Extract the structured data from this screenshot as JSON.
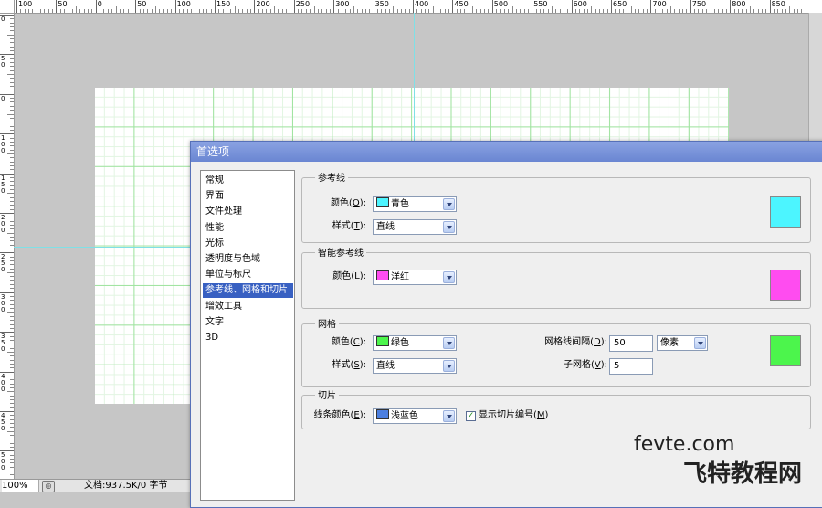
{
  "ruler": {
    "top_labels": [
      "100",
      "50",
      "0",
      "50",
      "100",
      "150",
      "200",
      "250",
      "300",
      "350",
      "400",
      "450",
      "500",
      "550",
      "600",
      "650",
      "700",
      "750",
      "800",
      "850"
    ],
    "left_labels": [
      "0",
      "50",
      "0",
      "100",
      "150",
      "200",
      "250",
      "300",
      "350",
      "400",
      "450",
      "500"
    ]
  },
  "status": {
    "zoom": "100%",
    "doc_info": "文档:937.5K/0 字节"
  },
  "dialog": {
    "title": "首选项",
    "nav_items": [
      "常规",
      "界面",
      "文件处理",
      "性能",
      "光标",
      "透明度与色域",
      "单位与标尺",
      "参考线、网格和切片",
      "增效工具",
      "文字",
      "3D"
    ],
    "selected_index": 7,
    "guides": {
      "title": "参考线",
      "color_label": "颜色(",
      "color_key": "O",
      "style_label": "样式(",
      "style_key": "T",
      "label_close": "):",
      "color_value": "青色",
      "color_hex": "#4cf5ff",
      "style_value": "直线"
    },
    "smart_guides": {
      "title": "智能参考线",
      "color_label": "颜色(",
      "color_key": "L",
      "label_close": "):",
      "color_value": "洋红",
      "color_hex": "#ff4cf0"
    },
    "grid": {
      "title": "网格",
      "color_label": "颜色(",
      "color_key": "C",
      "style_label": "样式(",
      "style_key": "S",
      "label_close": "):",
      "color_value": "绿色",
      "color_hex": "#4cf54c",
      "style_value": "直线",
      "spacing_label": "网格线间隔(",
      "spacing_key": "D",
      "spacing_value": "50",
      "unit_value": "像素",
      "subdiv_label": "子网格(",
      "subdiv_key": "V",
      "subdiv_value": "5"
    },
    "slices": {
      "title": "切片",
      "line_color_label": "线条颜色(",
      "line_color_key": "E",
      "label_close": "):",
      "line_color_value": "浅蓝色",
      "line_color_hex": "#4c7fe0",
      "show_numbers_label": "显示切片编号(",
      "show_numbers_key": "M",
      "show_numbers_close": ")",
      "show_numbers_checked": true,
      "check_glyph": "✓"
    }
  },
  "watermark": {
    "line1": "fevte.com",
    "line2": "飞特教程网"
  },
  "colors": {
    "accent": "#3860c2",
    "guide": "#7fe0e6",
    "grid_major": "#9fe39f",
    "grid_minor": "#e2f5e2"
  }
}
